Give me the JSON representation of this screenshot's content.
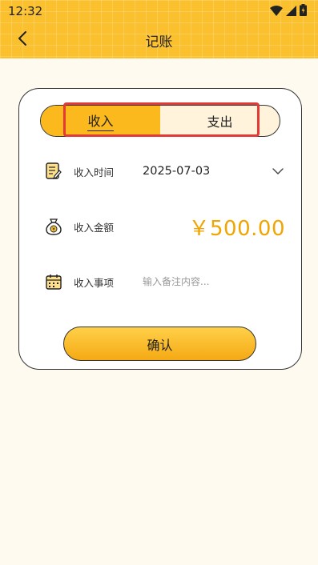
{
  "status_bar": {
    "time": "12:32"
  },
  "header": {
    "title": "记账"
  },
  "tabs": [
    {
      "label": "收入",
      "active": true
    },
    {
      "label": "支出",
      "active": false
    }
  ],
  "form": {
    "date_label": "收入时间",
    "date_value": "2025-07-03",
    "amount_label": "收入金额",
    "amount_value": "￥500.00",
    "note_label": "收入事项",
    "note_placeholder": "输入备注内容...",
    "note_value": ""
  },
  "confirm_label": "确认",
  "colors": {
    "accent": "#fbc02d",
    "amount": "#f0a500",
    "highlight": "#e53935",
    "background": "#fffaef"
  }
}
